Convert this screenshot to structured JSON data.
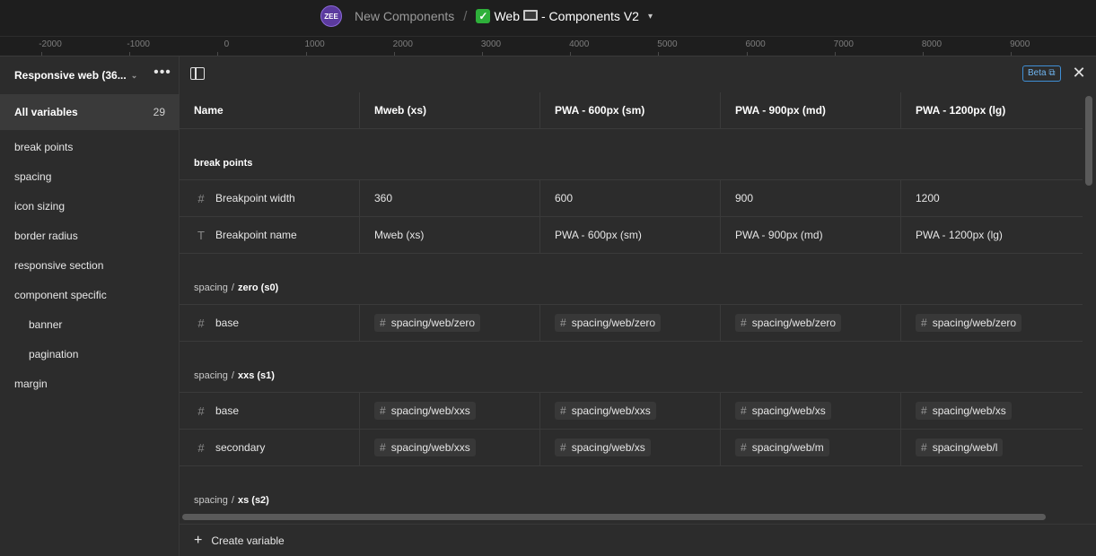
{
  "topbar": {
    "avatar_text": "ZEE",
    "project": "New Components",
    "separator": "/",
    "file_name": "Web",
    "file_suffix": "- Components V2"
  },
  "ruler": {
    "ticks": [
      "-2000",
      "-1000",
      "0",
      "1000",
      "2000",
      "3000",
      "4000",
      "5000",
      "6000",
      "7000",
      "8000",
      "9000"
    ]
  },
  "sidebar": {
    "collection": "Responsive web (36...",
    "all_variables_label": "All variables",
    "all_variables_count": "29",
    "groups": [
      "break points",
      "spacing",
      "icon sizing",
      "border radius",
      "responsive section",
      "component specific"
    ],
    "subgroups": [
      "banner",
      "pagination"
    ],
    "last_group": "margin"
  },
  "toolbar": {
    "beta_label": "Beta"
  },
  "table": {
    "headers": [
      "Name",
      "Mweb (xs)",
      "PWA - 600px (sm)",
      "PWA - 900px (md)",
      "PWA - 1200px (lg)"
    ],
    "sections": [
      {
        "path": "",
        "name": "break points",
        "rows": [
          {
            "type": "number",
            "name": "Breakpoint width",
            "values": [
              "360",
              "600",
              "900",
              "1200"
            ]
          },
          {
            "type": "string",
            "name": "Breakpoint name",
            "values": [
              "Mweb (xs)",
              "PWA - 600px (sm)",
              "PWA - 900px (md)",
              "PWA - 1200px (lg)"
            ]
          }
        ]
      },
      {
        "path": "spacing",
        "name": "zero (s0)",
        "rows": [
          {
            "type": "number",
            "name": "base",
            "values": [
              "spacing/web/zero",
              "spacing/web/zero",
              "spacing/web/zero",
              "spacing/web/zero"
            ]
          }
        ]
      },
      {
        "path": "spacing",
        "name": "xxs (s1)",
        "rows": [
          {
            "type": "number",
            "name": "base",
            "values": [
              "spacing/web/xxs",
              "spacing/web/xxs",
              "spacing/web/xs",
              "spacing/web/xs"
            ]
          },
          {
            "type": "number",
            "name": "secondary",
            "values": [
              "spacing/web/xxs",
              "spacing/web/xs",
              "spacing/web/m",
              "spacing/web/l"
            ]
          }
        ]
      },
      {
        "path": "spacing",
        "name": "xs (s2)",
        "rows": []
      }
    ]
  },
  "footer": {
    "create_label": "Create variable"
  },
  "icons": {
    "number_type": "hash-icon",
    "string_type": "text-type-icon",
    "alias": "hash-icon"
  }
}
